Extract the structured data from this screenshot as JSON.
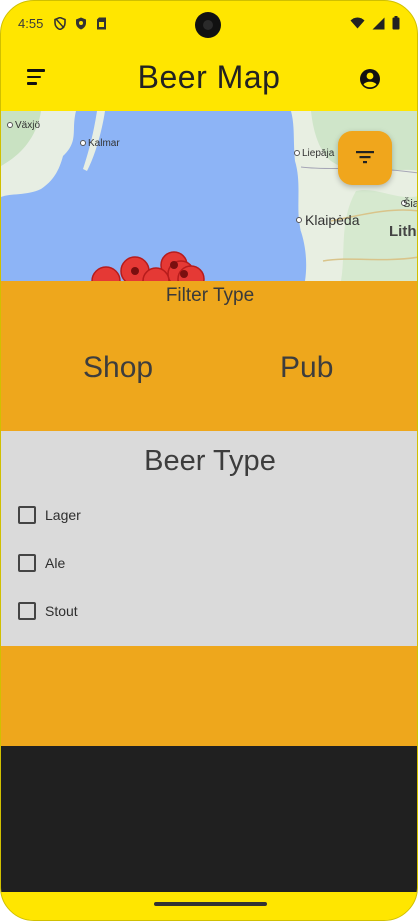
{
  "status_bar": {
    "time": "4:55",
    "icons": [
      "shield-icon",
      "shield-check-icon",
      "sim-card-icon",
      "wifi-icon",
      "signal-icon",
      "battery-icon"
    ]
  },
  "app_bar": {
    "title": "Beer Map",
    "menu_icon": "sort-menu-icon",
    "account_icon": "account-circle-icon",
    "color": "#ffe600"
  },
  "map": {
    "labels": {
      "vaxjo": "Växjö",
      "kalmar": "Kalmar",
      "liepaja": "Liepāja",
      "klaipeda": "Klaipėda",
      "siauliai": "Šia",
      "lithuania": "Lith"
    },
    "filter_button_icon": "filter-icon",
    "water_color": "#8db4f6",
    "land_color": "#e8efe2"
  },
  "filter_type": {
    "title": "Filter Type",
    "options": [
      "Shop",
      "Pub"
    ],
    "color": "#eea71c"
  },
  "beer_type": {
    "title": "Beer Type",
    "options": [
      {
        "label": "Lager",
        "checked": false
      },
      {
        "label": "Ale",
        "checked": false
      },
      {
        "label": "Stout",
        "checked": false
      }
    ]
  }
}
